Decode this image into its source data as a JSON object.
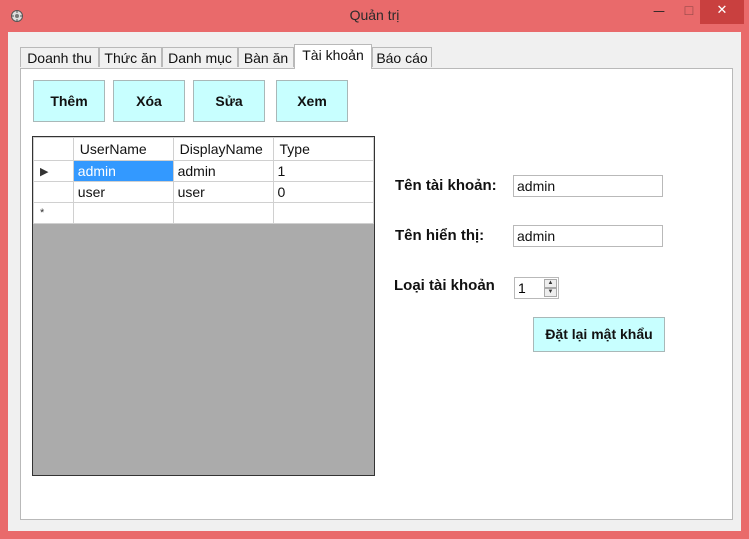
{
  "window": {
    "title": "Quản trị",
    "controls": {
      "minimize": "—",
      "maximize": "☐",
      "close": "✕"
    },
    "accent": "#e96a6b"
  },
  "tabs": [
    {
      "label": "Doanh thu"
    },
    {
      "label": "Thức ăn"
    },
    {
      "label": "Danh mục"
    },
    {
      "label": "Bàn ăn"
    },
    {
      "label": "Tài khoản",
      "active": true
    },
    {
      "label": "Báo cáo"
    }
  ],
  "toolbar": {
    "add_label": "Thêm",
    "delete_label": "Xóa",
    "edit_label": "Sửa",
    "view_label": "Xem"
  },
  "grid": {
    "columns": [
      "UserName",
      "DisplayName",
      "Type"
    ],
    "rows": [
      {
        "marker": "▶",
        "username": "admin",
        "displayname": "admin",
        "type": "1"
      },
      {
        "marker": "",
        "username": "user",
        "displayname": "user",
        "type": "0"
      }
    ],
    "new_row_marker": "*",
    "selection_color": "#3399ff"
  },
  "form": {
    "username_label": "Tên tài khoản:",
    "username_value": "admin",
    "displayname_label": "Tên hiển thị:",
    "displayname_value": "admin",
    "type_label": "Loại tài khoản",
    "type_value": "1",
    "reset_label": "Đặt lại mật khẩu"
  }
}
